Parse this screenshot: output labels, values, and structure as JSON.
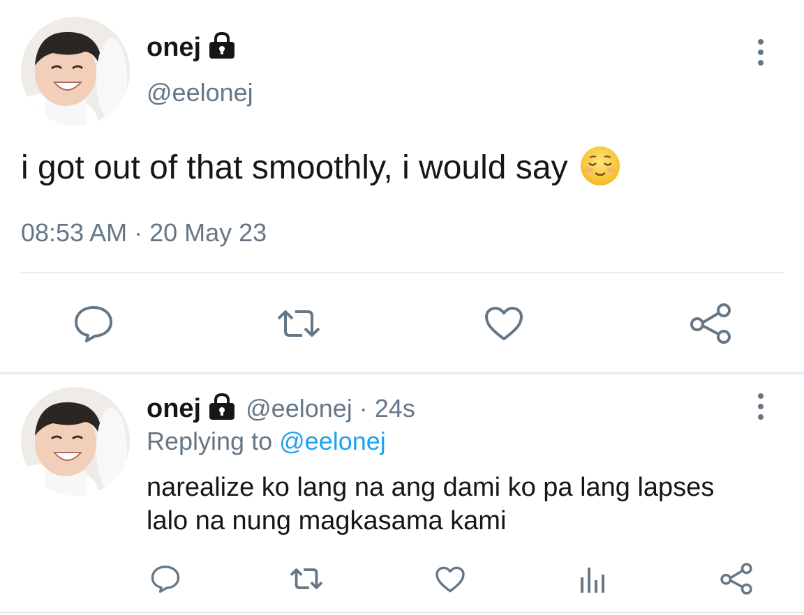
{
  "tweet": {
    "display_name": "onej",
    "handle": "@eelonej",
    "text": "i got out of that smoothly, i would say",
    "emoji": "relieved-face",
    "timestamp": "08:53 AM · 20 May 23",
    "actions": [
      "reply-icon",
      "retweet-icon",
      "like-icon",
      "share-icon"
    ]
  },
  "reply": {
    "display_name": "onej",
    "handle": "@eelonej",
    "time_sep": "·",
    "time": "24s",
    "replying_label": "Replying to",
    "replying_handle": "@eelonej",
    "text_line1": "narealize ko lang na ang dami ko pa lang lapses",
    "text_line2": "lalo na nung magkasama kami",
    "actions": [
      "reply-icon",
      "retweet-icon",
      "like-icon",
      "analytics-icon",
      "share-icon"
    ]
  },
  "colors": {
    "text": "#14171a",
    "muted": "#657786",
    "accent": "#1da1f2",
    "divider": "#e6ecf0"
  }
}
